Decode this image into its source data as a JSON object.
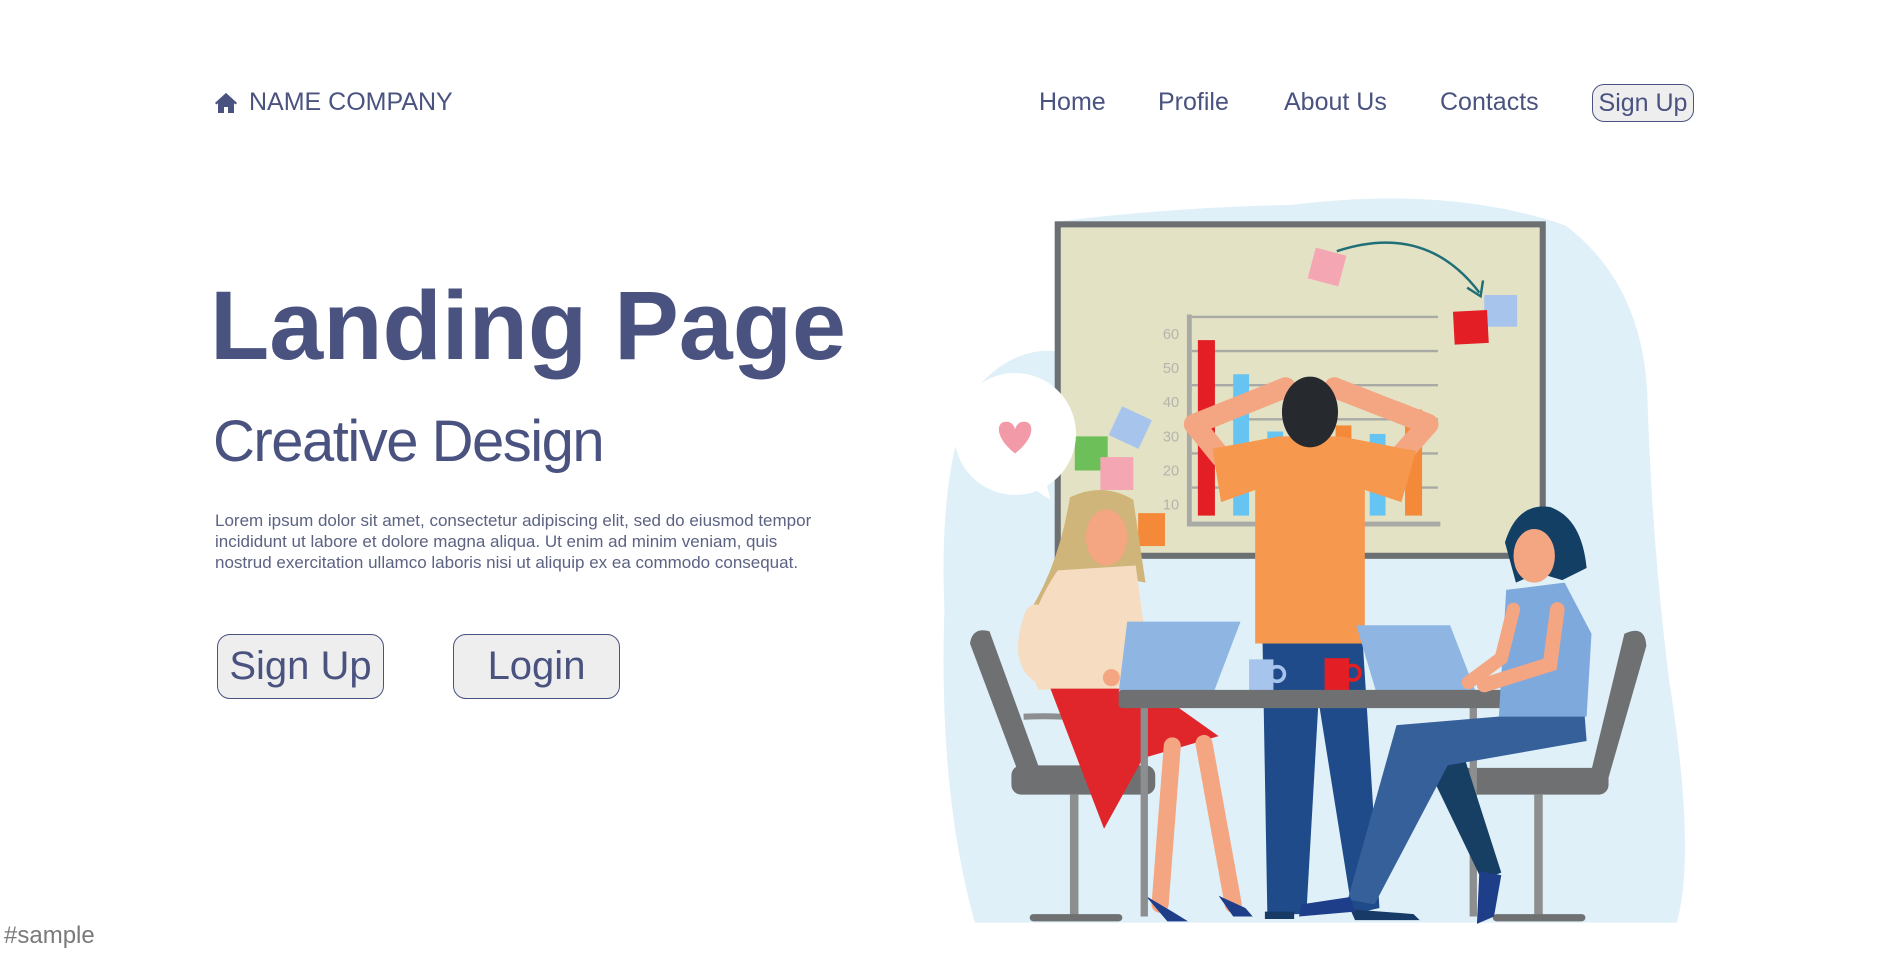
{
  "header": {
    "logo_icon": "home-icon",
    "company_name": "NAME COMPANY",
    "nav": [
      {
        "label": "Home"
      },
      {
        "label": "Profile"
      },
      {
        "label": "About Us"
      },
      {
        "label": "Contacts"
      }
    ],
    "signup_label": "Sign Up"
  },
  "hero": {
    "title": "Landing Page",
    "subtitle": "Creative Design",
    "body_lines": [
      "Lorem ipsum dolor sit amet, consectetur adipiscing elit, sed do eiusmod tempor",
      "incididunt ut labore et dolore magna aliqua. Ut enim ad minim veniam, quis",
      "nostrud exercitation ullamco laboris nisi ut aliquip ex ea commodo consequat."
    ],
    "signup_button": "Sign Up",
    "login_button": "Login"
  },
  "illustration": {
    "board_ticks": [
      "60",
      "50",
      "40",
      "30",
      "20",
      "10"
    ]
  },
  "watermark": "#sample",
  "colors": {
    "text": "#4a5380",
    "button_fill": "#eeeeee",
    "blob": "#dff0f8",
    "board": "#e3e2c4"
  }
}
